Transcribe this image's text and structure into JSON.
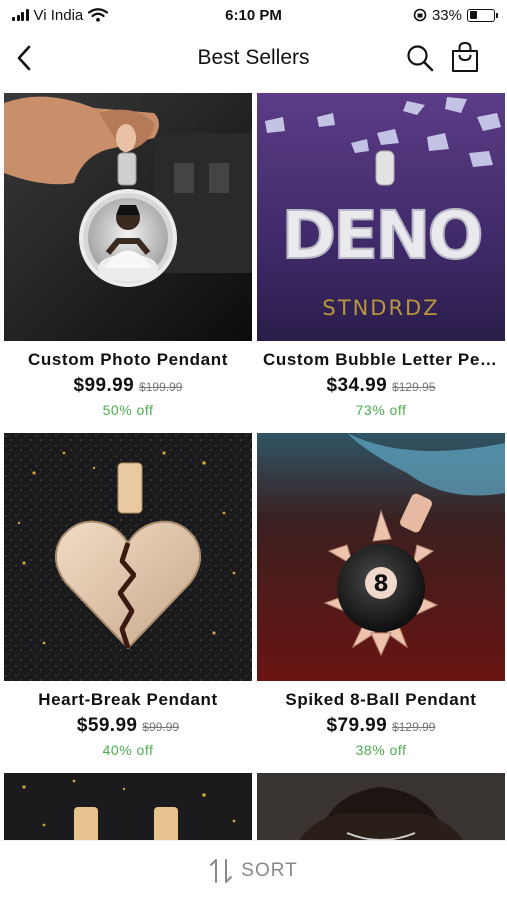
{
  "status_bar": {
    "carrier": "Vi India",
    "time": "6:10 PM",
    "battery": "33%",
    "battery_level": 0.33
  },
  "nav": {
    "title": "Best Sellers",
    "back_icon": "chevron-left-icon",
    "search_icon": "search-icon",
    "bag_icon": "shopping-bag-icon"
  },
  "products": [
    {
      "title": "Custom Photo Pendant",
      "price": "$99.99",
      "old_price": "$199.99",
      "discount": "50% off"
    },
    {
      "title": "Custom Bubble Letter Pendant",
      "price": "$34.99",
      "old_price": "$129.95",
      "discount": "73% off",
      "image_text_1": "DENO",
      "image_text_2": "STNDRDZ"
    },
    {
      "title": "Heart-Break Pendant",
      "price": "$59.99",
      "old_price": "$99.99",
      "discount": "40% off"
    },
    {
      "title": "Spiked 8-Ball Pendant",
      "price": "$79.99",
      "old_price": "$129.99",
      "discount": "38% off",
      "image_text_1": "8"
    }
  ],
  "sort": {
    "label": "SORT",
    "icon": "sort-arrows-icon"
  },
  "colors": {
    "discount": "#4caf50",
    "old_price": "#777777",
    "sort_label": "#888888"
  }
}
